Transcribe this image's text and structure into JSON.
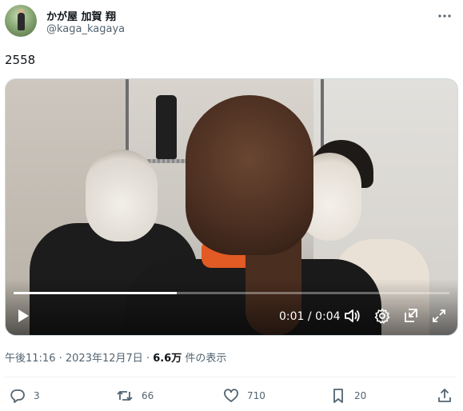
{
  "author": {
    "display_name": "かが屋 加賀 翔",
    "handle": "@kaga_kagaya",
    "more_icon": "more-dots-icon"
  },
  "tweet": {
    "text": "2558"
  },
  "video": {
    "current_time": "0:01",
    "separator": " / ",
    "duration": "0:04",
    "progress": 0.375,
    "icons": [
      "play-icon",
      "volume-icon",
      "settings-icon",
      "pip-icon",
      "fullscreen-icon"
    ]
  },
  "meta": {
    "time": "午後11:16",
    "sep1": " · ",
    "date": "2023年12月7日",
    "sep2": " · ",
    "views_count": "6.6万",
    "views_label": " 件の表示"
  },
  "actions": {
    "reply": {
      "icon": "reply-icon",
      "count": "3"
    },
    "repost": {
      "icon": "repost-icon",
      "count": "66"
    },
    "like": {
      "icon": "heart-icon",
      "count": "710"
    },
    "bookmark": {
      "icon": "bookmark-icon",
      "count": "20"
    },
    "share": {
      "icon": "share-icon"
    }
  },
  "colors": {
    "text_primary": "#0f1419",
    "text_secondary": "#536471",
    "divider": "#eff3f4"
  }
}
